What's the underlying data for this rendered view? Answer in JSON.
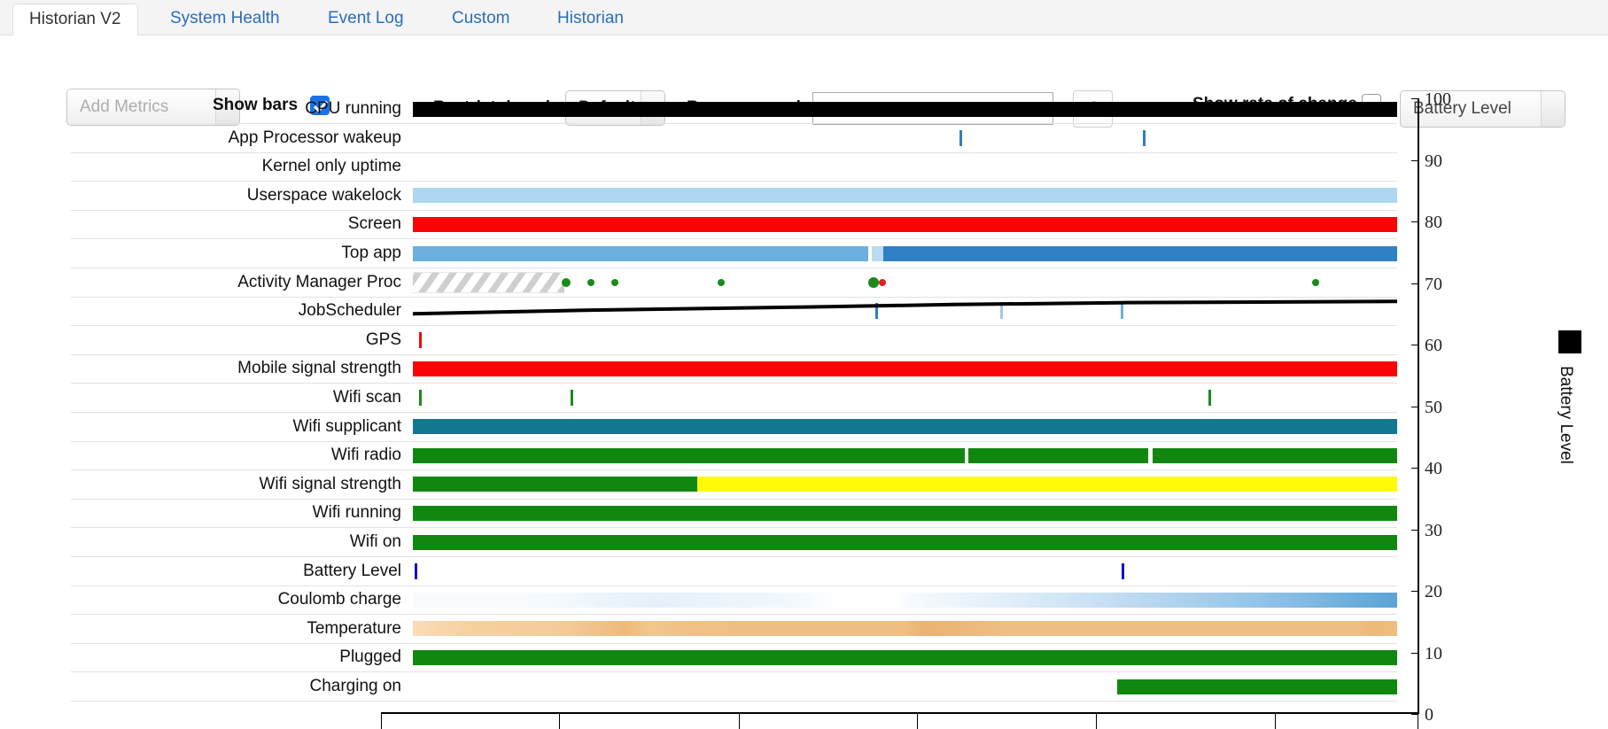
{
  "tabs": [
    {
      "label": "Historian V2",
      "active": true
    },
    {
      "label": "System Health",
      "active": false
    },
    {
      "label": "Event Log",
      "active": false
    },
    {
      "label": "Custom",
      "active": false
    },
    {
      "label": "Historian",
      "active": false
    }
  ],
  "toolbar": {
    "add_metrics_label": "Add Metrics",
    "show_bars_label": "Show bars",
    "show_bars_checked": true,
    "restrict_domain_label": "Restrict domain",
    "restrict_domain_value": "Default",
    "regexp_search_label": "Regexp search",
    "regexp_search_value": "",
    "regexp_search_placeholder": "",
    "settings_icon": "gear-icon",
    "show_rate_of_change_label": "Show rate of change",
    "show_rate_of_change_checked": false,
    "metric_select_value": "Battery Level"
  },
  "chart_data": {
    "type": "timeline",
    "title": "",
    "xlabel": "",
    "ylabel": "Battery Level",
    "ylim": [
      0,
      100
    ],
    "yticks": [
      100,
      90,
      80,
      70,
      60,
      50,
      40,
      30,
      20,
      10,
      0
    ],
    "legend": [
      {
        "name": "Battery Level",
        "color": "#000000"
      }
    ],
    "legend_position": "right",
    "grid": true,
    "rows": [
      {
        "label": "CPU running",
        "kind": "bar",
        "color": "#000000",
        "segments": [
          [
            0.0,
            1.0,
            "#000000"
          ]
        ]
      },
      {
        "label": "App Processor wakeup",
        "kind": "ticks",
        "color": "#2f7fc1",
        "marks": [
          0.555,
          0.742
        ]
      },
      {
        "label": "Kernel only uptime",
        "kind": "empty",
        "color": "#888888",
        "segments": []
      },
      {
        "label": "Userspace wakelock",
        "kind": "bar",
        "color": "#aed8ef",
        "segments": [
          [
            0.0,
            1.0,
            "#aed8ef"
          ]
        ]
      },
      {
        "label": "Screen",
        "kind": "bar",
        "color": "#fa0505",
        "segments": [
          [
            0.0,
            1.0,
            "#fa0505"
          ]
        ]
      },
      {
        "label": "Top app",
        "kind": "bar",
        "color": "#6aafdd",
        "segments": [
          [
            0.0,
            0.463,
            "#6aafdd"
          ],
          [
            0.466,
            0.478,
            "#b9dcf0"
          ],
          [
            0.478,
            1.0,
            "#2f80c4"
          ]
        ]
      },
      {
        "label": "Activity Manager Proc",
        "kind": "hatch-dots",
        "color": "#cfcfcf",
        "hatch": [
          0.0,
          0.154
        ],
        "dots": [
          {
            "x": 0.156,
            "color": "#1a8a1a",
            "r": 5
          },
          {
            "x": 0.181,
            "color": "#1a8a1a",
            "r": 4
          },
          {
            "x": 0.205,
            "color": "#1a8a1a",
            "r": 4
          },
          {
            "x": 0.313,
            "color": "#1a8a1a",
            "r": 4
          },
          {
            "x": 0.468,
            "color": "#1a8a1a",
            "r": 6
          },
          {
            "x": 0.477,
            "color": "#e02020",
            "r": 4
          },
          {
            "x": 0.917,
            "color": "#1a8a1a",
            "r": 4
          }
        ]
      },
      {
        "label": "JobScheduler",
        "kind": "ticks",
        "color": "#2f7fc1",
        "marks": [
          0.47,
          0.597,
          0.719
        ],
        "mark_colors": [
          "#2f7fc1",
          "#9ecbe8",
          "#6aafdd"
        ]
      },
      {
        "label": "GPS",
        "kind": "ticks",
        "color": "#fa0505",
        "marks": [
          0.006
        ]
      },
      {
        "label": "Mobile signal strength",
        "kind": "bar",
        "color": "#fa0505",
        "segments": [
          [
            0.0,
            1.0,
            "#fa0505"
          ]
        ]
      },
      {
        "label": "Wifi scan",
        "kind": "ticks",
        "color": "#1a8a1a",
        "marks": [
          0.006,
          0.16,
          0.808
        ]
      },
      {
        "label": "Wifi supplicant",
        "kind": "bar",
        "color": "#10788f",
        "segments": [
          [
            0.0,
            1.0,
            "#10788f"
          ]
        ]
      },
      {
        "label": "Wifi radio",
        "kind": "bar",
        "color": "#108810",
        "segments": [
          [
            0.0,
            0.561,
            "#108810"
          ],
          [
            0.564,
            0.747,
            "#108810"
          ],
          [
            0.752,
            1.0,
            "#108810"
          ]
        ]
      },
      {
        "label": "Wifi signal strength",
        "kind": "bar",
        "color": "#108810",
        "segments": [
          [
            0.0,
            0.289,
            "#108810"
          ],
          [
            0.289,
            1.0,
            "#fffb07"
          ]
        ]
      },
      {
        "label": "Wifi running",
        "kind": "bar",
        "color": "#108810",
        "segments": [
          [
            0.0,
            1.0,
            "#108810"
          ]
        ]
      },
      {
        "label": "Wifi on",
        "kind": "bar",
        "color": "#108810",
        "segments": [
          [
            0.0,
            1.0,
            "#108810"
          ]
        ]
      },
      {
        "label": "Battery Level",
        "kind": "ticks",
        "color": "#1111cc",
        "marks": [
          0.002,
          0.72
        ]
      },
      {
        "label": "Coulomb charge",
        "kind": "gradient",
        "color": "#7fb8e0",
        "gradient_stops": [
          [
            0.113,
            "#f7fbfe"
          ],
          [
            0.16,
            "#f2f8fd"
          ],
          [
            0.2,
            "#eaf4fb"
          ],
          [
            0.25,
            "#e4f0fa"
          ],
          [
            0.3,
            "#eaf4fb"
          ],
          [
            0.35,
            "#edf6fc"
          ],
          [
            0.4,
            "#f4fafe"
          ],
          [
            0.43,
            "#ffffff"
          ],
          [
            0.49,
            "#ffffff"
          ],
          [
            0.5,
            "#f7fbfe"
          ],
          [
            0.56,
            "#eaf4fb"
          ],
          [
            0.62,
            "#dcecf8"
          ],
          [
            0.69,
            "#c9e1f4"
          ],
          [
            0.76,
            "#b4d5ef"
          ],
          [
            0.83,
            "#9dc9ea"
          ],
          [
            0.9,
            "#84bbe4"
          ],
          [
            0.96,
            "#6aaddd"
          ],
          [
            1.0,
            "#5ba3d8"
          ]
        ]
      },
      {
        "label": "Temperature",
        "kind": "gradient",
        "color": "#efb980",
        "gradient_stops": [
          [
            0.0,
            "#fadcb6"
          ],
          [
            0.06,
            "#f6d0a0"
          ],
          [
            0.15,
            "#f4cb98"
          ],
          [
            0.195,
            "#f0c086"
          ],
          [
            0.215,
            "#eeba7c"
          ],
          [
            0.24,
            "#f2c68f"
          ],
          [
            0.28,
            "#f0c186"
          ],
          [
            0.33,
            "#efbe82"
          ],
          [
            0.5,
            "#efbe82"
          ],
          [
            0.52,
            "#eab273"
          ],
          [
            0.6,
            "#efbe82"
          ],
          [
            0.96,
            "#efbe82"
          ],
          [
            0.975,
            "#eeb978"
          ],
          [
            1.0,
            "#efbe82"
          ]
        ]
      },
      {
        "label": "Plugged",
        "kind": "bar",
        "color": "#108810",
        "segments": [
          [
            0.0,
            1.0,
            "#108810"
          ]
        ]
      },
      {
        "label": "Charging on",
        "kind": "bar",
        "color": "#108810",
        "segments": [
          [
            0.716,
            1.0,
            "#108810"
          ]
        ]
      }
    ],
    "battery_series": [
      {
        "x": 0.0,
        "y": 65.0
      },
      {
        "x": 0.18,
        "y": 65.6
      },
      {
        "x": 0.4,
        "y": 66.1
      },
      {
        "x": 0.55,
        "y": 66.5
      },
      {
        "x": 0.72,
        "y": 66.8
      },
      {
        "x": 1.0,
        "y": 67.0
      }
    ],
    "xticks": [
      0.0,
      0.172,
      0.345,
      0.517,
      0.69,
      0.862,
      1.0
    ]
  }
}
